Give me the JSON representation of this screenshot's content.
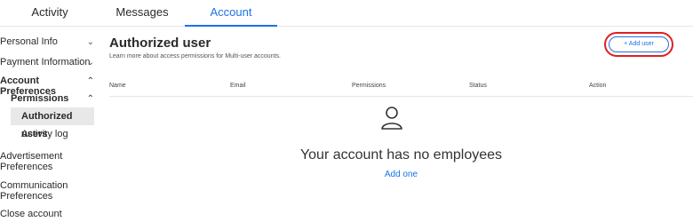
{
  "tabs": [
    {
      "label": "Activity",
      "active": false
    },
    {
      "label": "Messages",
      "active": false
    },
    {
      "label": "Account",
      "active": true
    }
  ],
  "sidebar": {
    "items": [
      {
        "label": "Personal Info",
        "chevron": "chevron-down-icon"
      },
      {
        "label": "Payment Information",
        "chevron": "chevron-down-icon"
      },
      {
        "label": "Account Preferences",
        "chevron": "chevron-up-icon"
      },
      {
        "label": "Permissions",
        "chevron": "chevron-up-icon"
      },
      {
        "label": "Authorized users",
        "active": true
      },
      {
        "label": "Activity log"
      },
      {
        "label": "Advertisement Preferences"
      },
      {
        "label": "Communication Preferences"
      },
      {
        "label": "Close account"
      }
    ]
  },
  "main": {
    "title": "Authorized user",
    "subtitle": "Learn more about access permissions for Multi-user accounts.",
    "add_button": "+ Add user",
    "columns": [
      "Name",
      "Email",
      "Permissions",
      "Status",
      "Action"
    ],
    "empty": {
      "icon": "user-icon",
      "title": "Your account has no employees",
      "link": "Add one"
    }
  },
  "colors": {
    "accent": "#1a73e8",
    "highlight": "#e02020",
    "active_bg": "#e8e8e8"
  }
}
